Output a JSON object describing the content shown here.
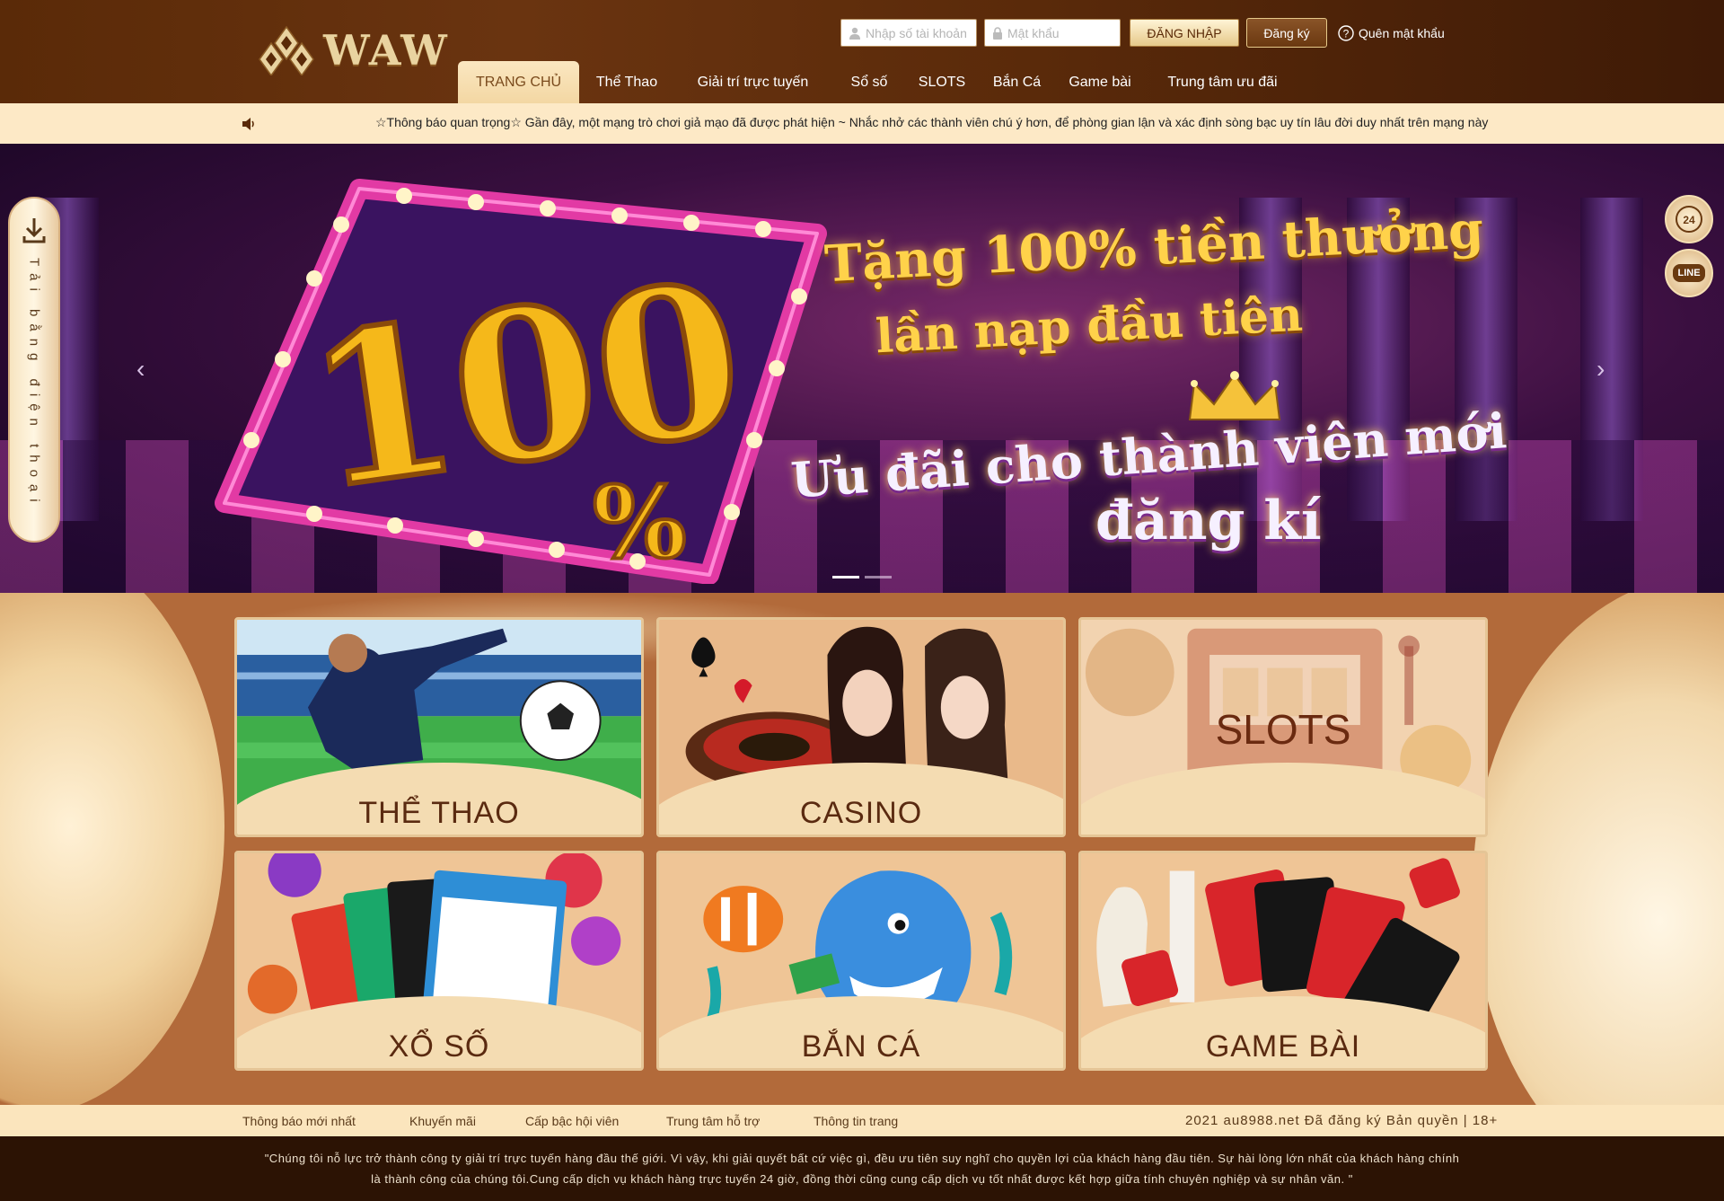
{
  "brand": {
    "name": "WAW"
  },
  "login": {
    "username_placeholder": "Nhập số tài khoản",
    "password_placeholder": "Mật khẩu",
    "login_label": "ĐĂNG NHẬP",
    "register_label": "Đăng ký",
    "forgot_label": "Quên mật khẩu"
  },
  "nav": {
    "items": [
      "TRANG CHỦ",
      "Thể Thao",
      "Giải trí trực tuyến",
      "Sổ số",
      "SLOTS",
      "Bắn Cá",
      "Game bài",
      "Trung tâm ưu đãi"
    ],
    "active_index": 0
  },
  "notice": {
    "text": "☆Thông báo quan trọng☆ Gần đây, một mạng trò chơi giả mạo đã được phát hiện ~ Nhắc nhở các thành viên chú ý hơn, để phòng gian lận và xác định sòng bạc uy tín lâu đời duy nhất trên mạng này"
  },
  "banner": {
    "big_number": "100",
    "percent": "%",
    "line1": "Tặng 100% tiền thưởng",
    "line2": "lần nạp đầu tiên",
    "line3": "Ưu đãi cho thành viên mới",
    "line4": "đăng kí",
    "prev": "‹",
    "next": "›",
    "slide_count": 2,
    "active_slide": 0
  },
  "side": {
    "download_label": "Tải bằng điện thoại",
    "support_label": "24",
    "line_label": "LINE"
  },
  "games": [
    {
      "label": "THỂ THAO"
    },
    {
      "label": "CASINO"
    },
    {
      "label": "SLOTS"
    },
    {
      "label": "XỔ SỐ"
    },
    {
      "label": "BẮN CÁ"
    },
    {
      "label": "GAME BÀI"
    }
  ],
  "footer": {
    "links": [
      "Thông báo mới nhất",
      "Khuyến mãi",
      "Cấp bậc hội viên",
      "Trung tâm hỗ trợ",
      "Thông tin trang"
    ],
    "copyright": "2021 au8988.net Đã đăng ký Bản quyền | 18+",
    "statement_line1": "\"Chúng tôi nỗ lực trở thành công ty giải trí trực tuyến hàng đầu thế giới. Vì vậy, khi giải quyết bất cứ việc gì, đều ưu tiên suy nghĩ cho quyền lợi của khách hàng đầu tiên. Sự hài lòng lớn nhất của khách hàng chính",
    "statement_line2": "là thành công của chúng tôi.Cung cấp dịch vụ khách hàng trực tuyến 24 giờ, đồng thời cũng cung cấp dịch vụ tốt nhất được kết hợp giữa tính chuyên nghiệp và sự nhân văn. \""
  },
  "colors": {
    "header_brown": "#5a2a08",
    "cream": "#fde9c6",
    "games_bg": "#b26a3a",
    "gold": "#ffd24a",
    "footer_dark": "#2c1304"
  }
}
